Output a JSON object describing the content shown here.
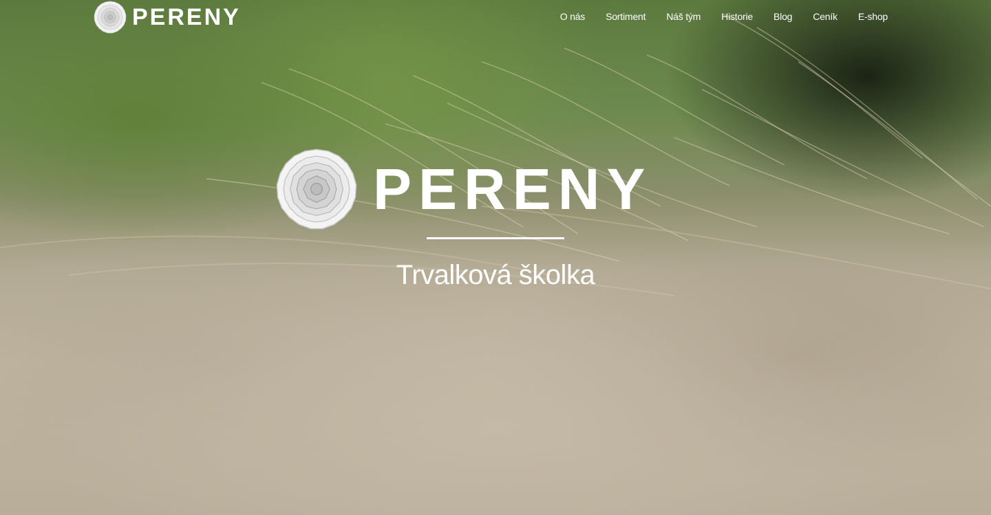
{
  "brand": {
    "name": "PERENY",
    "logo_icon": "rosette-flower-icon"
  },
  "nav": {
    "items": [
      {
        "label": "O nás"
      },
      {
        "label": "Sortiment"
      },
      {
        "label": "Náš tým"
      },
      {
        "label": "Historie"
      },
      {
        "label": "Blog"
      },
      {
        "label": "Ceník"
      },
      {
        "label": "E-shop"
      }
    ]
  },
  "hero": {
    "title": "PERENY",
    "tagline": "Trvalková školka",
    "background": "ornamental-grass-photo"
  },
  "colors": {
    "text": "#ffffff",
    "grass_green": "#6e8a4f",
    "grass_beige": "#c1b7a3"
  }
}
